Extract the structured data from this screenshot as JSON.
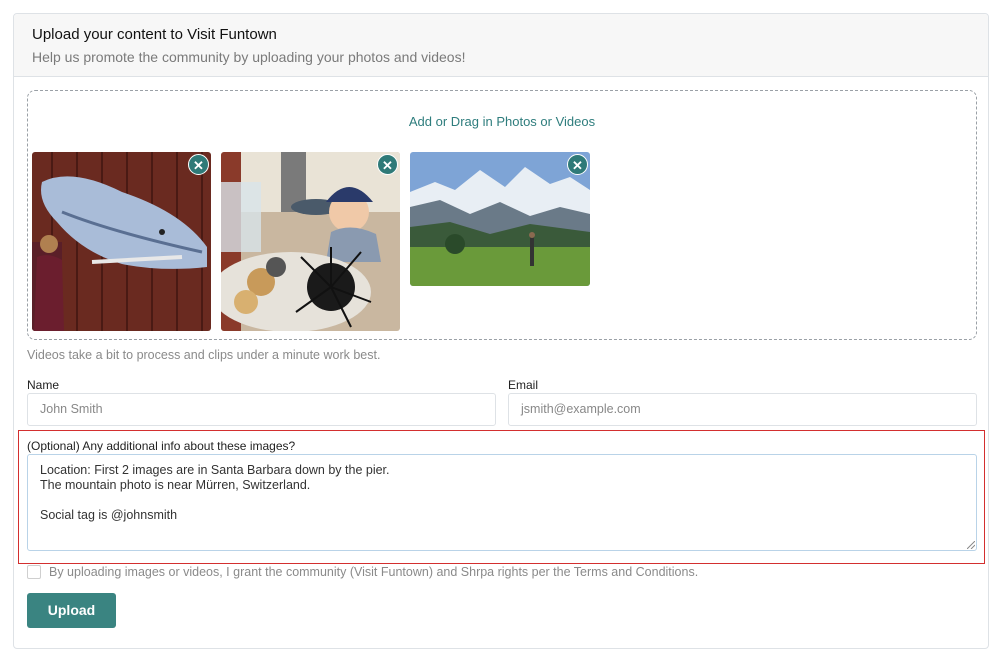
{
  "header": {
    "title": "Upload your content to Visit Funtown",
    "subtitle": "Help us promote the community by uploading your photos and videos!"
  },
  "dropzone": {
    "label": "Add or Drag in Photos or Videos",
    "thumbnails": [
      {
        "subject": "whale mural with woman",
        "remove_icon": "close-icon"
      },
      {
        "subject": "toddler at table with sea urchin",
        "remove_icon": "close-icon"
      },
      {
        "subject": "mountain meadow",
        "remove_icon": "close-icon"
      }
    ]
  },
  "hint": "Videos take a bit to process and clips under a minute work best.",
  "form": {
    "name_label": "Name",
    "name_placeholder": "John Smith",
    "email_label": "Email",
    "email_placeholder": "jsmith@example.com",
    "info_label": "(Optional) Any additional info about these images?",
    "info_value": "Location: First 2 images are in Santa Barbara down by the pier.\nThe mountain photo is near Mürren, Switzerland.\n\nSocial tag is @johnsmith",
    "consent_text": "By uploading images or videos, I grant the community (Visit Funtown) and Shrpa rights per the Terms and Conditions.",
    "consent_checked": false,
    "submit_label": "Upload"
  },
  "colors": {
    "accent": "#3a8481",
    "highlight": "#d32f2f"
  }
}
